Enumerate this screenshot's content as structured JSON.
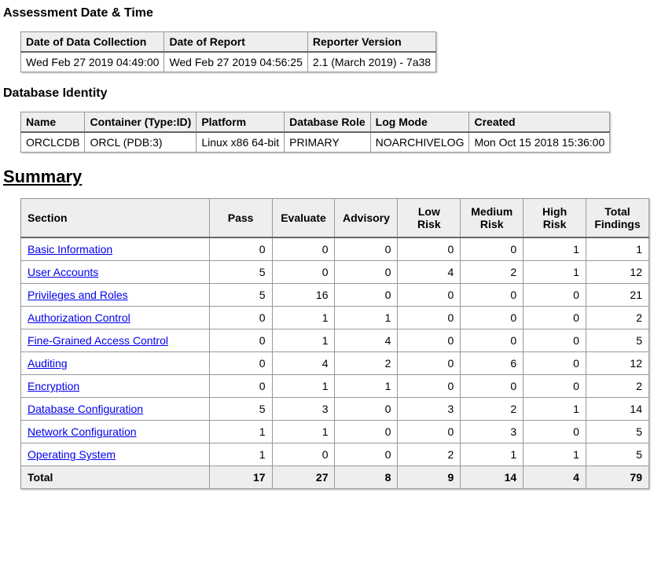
{
  "headings": {
    "assessment": "Assessment Date & Time",
    "identity": "Database Identity",
    "summary": "Summary"
  },
  "assessment": {
    "headers": [
      "Date of Data Collection",
      "Date of Report",
      "Reporter Version"
    ],
    "row": [
      "Wed Feb 27 2019 04:49:00",
      "Wed Feb 27 2019 04:56:25",
      "2.1 (March 2019) - 7a38"
    ]
  },
  "identity": {
    "headers": [
      "Name",
      "Container (Type:ID)",
      "Platform",
      "Database Role",
      "Log Mode",
      "Created"
    ],
    "row": [
      "ORCLCDB",
      "ORCL (PDB:3)",
      "Linux x86 64-bit",
      "PRIMARY",
      "NOARCHIVELOG",
      "Mon Oct 15 2018 15:36:00"
    ]
  },
  "summary": {
    "headers": {
      "section": "Section",
      "pass": "Pass",
      "evaluate": "Evaluate",
      "advisory": "Advisory",
      "low": "Low\nRisk",
      "medium": "Medium\nRisk",
      "high": "High\nRisk",
      "total": "Total\nFindings"
    },
    "rows": [
      {
        "section": "Basic Information",
        "pass": 0,
        "evaluate": 0,
        "advisory": 0,
        "low": 0,
        "medium": 0,
        "high": 1,
        "total": 1
      },
      {
        "section": "User Accounts",
        "pass": 5,
        "evaluate": 0,
        "advisory": 0,
        "low": 4,
        "medium": 2,
        "high": 1,
        "total": 12
      },
      {
        "section": "Privileges and Roles",
        "pass": 5,
        "evaluate": 16,
        "advisory": 0,
        "low": 0,
        "medium": 0,
        "high": 0,
        "total": 21
      },
      {
        "section": "Authorization Control",
        "pass": 0,
        "evaluate": 1,
        "advisory": 1,
        "low": 0,
        "medium": 0,
        "high": 0,
        "total": 2
      },
      {
        "section": "Fine-Grained Access Control",
        "pass": 0,
        "evaluate": 1,
        "advisory": 4,
        "low": 0,
        "medium": 0,
        "high": 0,
        "total": 5
      },
      {
        "section": "Auditing",
        "pass": 0,
        "evaluate": 4,
        "advisory": 2,
        "low": 0,
        "medium": 6,
        "high": 0,
        "total": 12
      },
      {
        "section": "Encryption",
        "pass": 0,
        "evaluate": 1,
        "advisory": 1,
        "low": 0,
        "medium": 0,
        "high": 0,
        "total": 2
      },
      {
        "section": "Database Configuration",
        "pass": 5,
        "evaluate": 3,
        "advisory": 0,
        "low": 3,
        "medium": 2,
        "high": 1,
        "total": 14
      },
      {
        "section": "Network Configuration",
        "pass": 1,
        "evaluate": 1,
        "advisory": 0,
        "low": 0,
        "medium": 3,
        "high": 0,
        "total": 5
      },
      {
        "section": "Operating System",
        "pass": 1,
        "evaluate": 0,
        "advisory": 0,
        "low": 2,
        "medium": 1,
        "high": 1,
        "total": 5
      }
    ],
    "totalLabel": "Total",
    "totals": {
      "pass": 17,
      "evaluate": 27,
      "advisory": 8,
      "low": 9,
      "medium": 14,
      "high": 4,
      "total": 79
    }
  }
}
